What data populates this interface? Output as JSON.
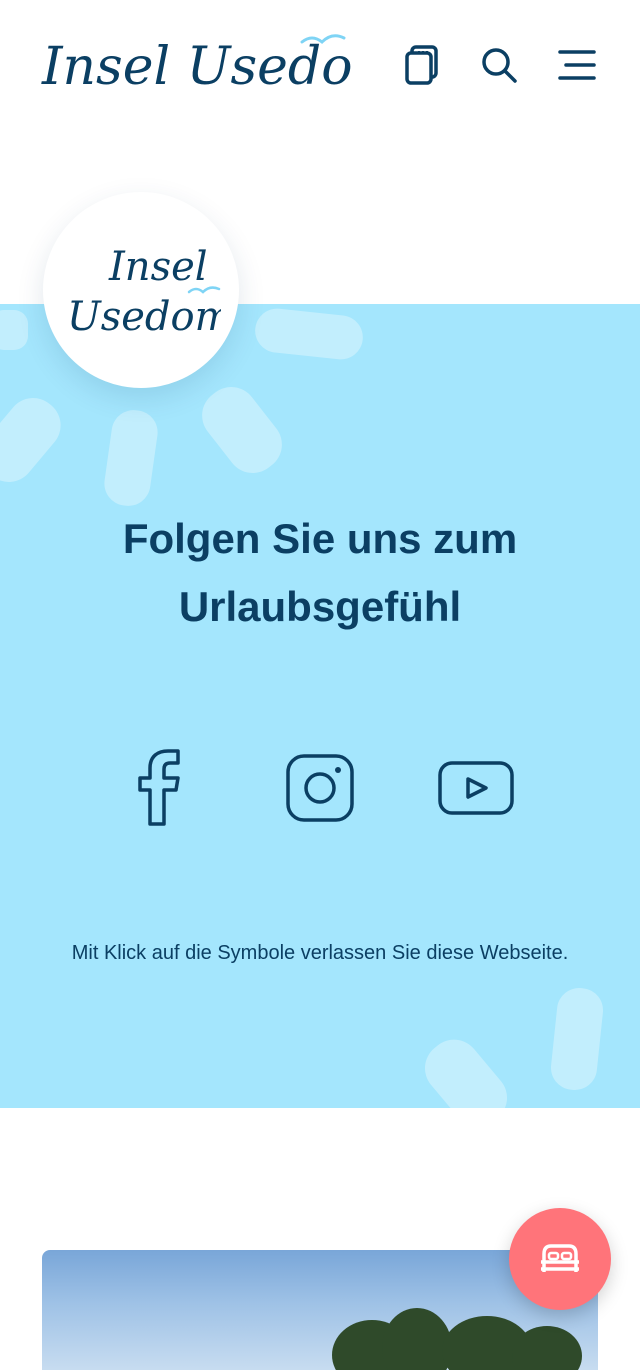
{
  "header": {
    "logo_text": "Insel Usedom",
    "icons": [
      "brochure-icon",
      "search-icon",
      "menu-icon"
    ]
  },
  "badge": {
    "logo_line1": "Insel",
    "logo_line2": "Usedom"
  },
  "social_section": {
    "heading_line1": "Folgen Sie uns zum",
    "heading_line2": "Urlaubsgefühl",
    "links": [
      "facebook-icon",
      "instagram-icon",
      "youtube-icon"
    ],
    "note": "Mit Klick auf die Symbole verlassen Sie diese Webseite."
  },
  "fab": {
    "icon": "bed-icon"
  },
  "colors": {
    "primary": "#0b3f63",
    "band": "#a4e6fd",
    "accent_gull": "#7fd4f5",
    "fab": "#ff747a"
  }
}
